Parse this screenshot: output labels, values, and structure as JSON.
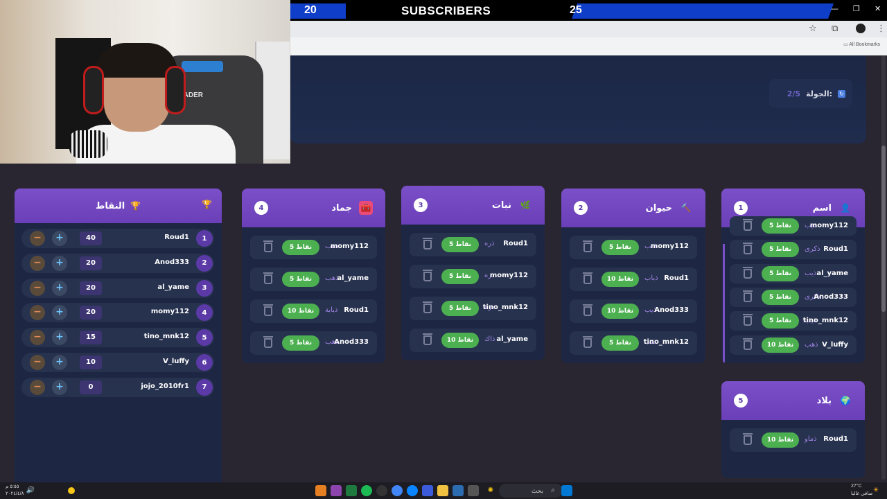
{
  "stream": {
    "subscribers_current": "20",
    "subscribers_label": "SUBSCRIBERS",
    "subscribers_goal": "25"
  },
  "browser": {
    "bookmarks_label": "All Bookmarks"
  },
  "round": {
    "label": "الجولة:",
    "value": "2/5"
  },
  "points": {
    "title": "النقاط",
    "rows": [
      {
        "rank": "1",
        "name": "Roud1",
        "score": "40"
      },
      {
        "rank": "2",
        "name": "Anod333",
        "score": "20"
      },
      {
        "rank": "3",
        "name": "al_yame",
        "score": "20"
      },
      {
        "rank": "4",
        "name": "momy112",
        "score": "20"
      },
      {
        "rank": "5",
        "name": "tino_mnk12",
        "score": "15"
      },
      {
        "rank": "6",
        "name": "V_luffy",
        "score": "10"
      },
      {
        "rank": "7",
        "name": "jojo_2010fr1",
        "score": "0"
      }
    ]
  },
  "categories": [
    {
      "num": "4",
      "title": "جماد",
      "icon": "toolbox-icon",
      "entries": [
        {
          "name": "momy112",
          "word": "ذهب",
          "pts": "5 نقاط"
        },
        {
          "name": "al_yame",
          "word": "ذهب",
          "pts": "5 نقاط"
        },
        {
          "name": "Roud1",
          "word": "ذبابة",
          "pts": "10 نقاط"
        },
        {
          "name": "Anod333",
          "word": "ذهب",
          "pts": "5 نقاط"
        }
      ]
    },
    {
      "num": "3",
      "title": "نبات",
      "icon": "leaf-icon",
      "entries": [
        {
          "name": "Roud1",
          "word": "ذره",
          "pts": "5 نقاط"
        },
        {
          "name": "momy112",
          "word": "ذره",
          "pts": "5 نقاط"
        },
        {
          "name": "tino_mnk12",
          "word": "ذره",
          "pts": "5 نقاط"
        },
        {
          "name": "al_yame",
          "word": "ذاك",
          "pts": "10 نقاط"
        }
      ]
    },
    {
      "num": "2",
      "title": "حيوان",
      "icon": "paw-icon",
      "entries": [
        {
          "name": "momy112",
          "word": "ذئب",
          "pts": "5 نقاط"
        },
        {
          "name": "Roud1",
          "word": "ذباب",
          "pts": "10 نقاط"
        },
        {
          "name": "Anod333",
          "word": "ذيب",
          "pts": "10 نقاط"
        },
        {
          "name": "tino_mnk12",
          "word": "ذئب",
          "pts": "5 نقاط"
        }
      ]
    },
    {
      "num": "1",
      "title": "اسم",
      "icon": "user-icon",
      "entries": [
        {
          "name": "momy112",
          "word": "ذيب",
          "pts": "5 نقاط"
        },
        {
          "name": "Roud1",
          "word": "ذكرى",
          "pts": "5 نقاط"
        },
        {
          "name": "al_yame",
          "word": "ذيب",
          "pts": "5 نقاط"
        },
        {
          "name": "Anod333",
          "word": "ذكرى",
          "pts": "5 نقاط"
        },
        {
          "name": "tino_mnk12",
          "word": "ذيب",
          "pts": "5 نقاط"
        },
        {
          "name": "V_luffy",
          "word": "ذهب",
          "pts": "10 نقاط"
        }
      ]
    },
    {
      "num": "5",
      "title": "بلاد",
      "icon": "globe-icon",
      "entries": [
        {
          "name": "Roud1",
          "word": "ذماو",
          "pts": "10 نقاط"
        }
      ]
    }
  ],
  "taskbar": {
    "search_label": "بحث",
    "weather_temp": "27°C",
    "weather_desc": "صافي غالبا",
    "time": "٥:٥٥ م",
    "date": "٢٠٢٤/٤/٨"
  },
  "colors": {
    "accent_purple": "#6a3fb8",
    "points_green": "#4caf50",
    "card_bg": "#1d2744",
    "subs_blue": "#0f3ec9"
  }
}
